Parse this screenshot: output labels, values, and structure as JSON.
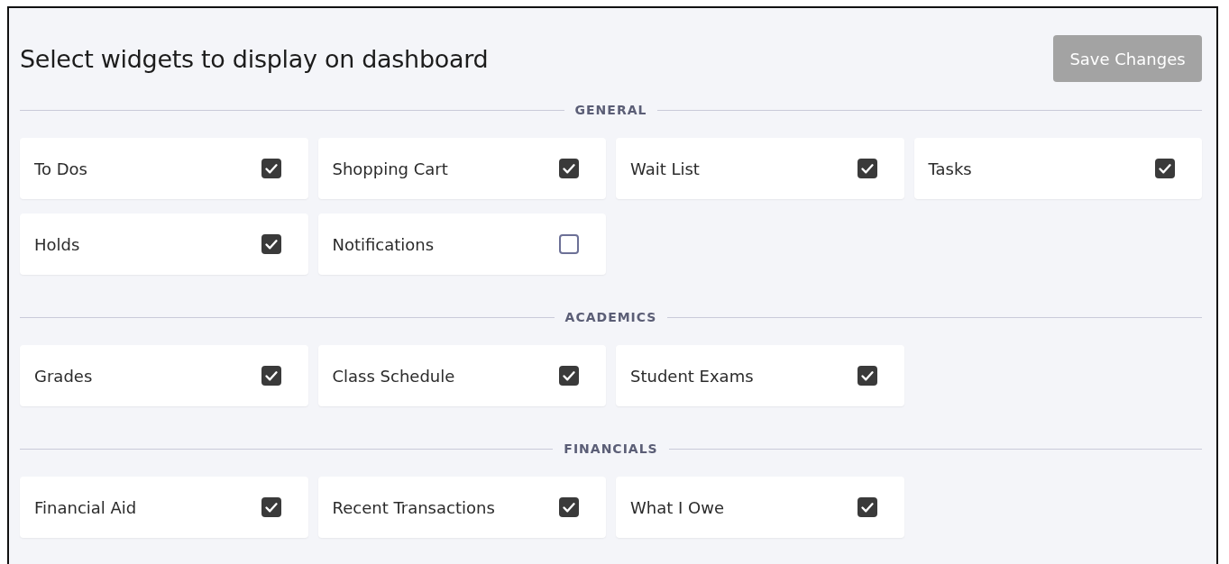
{
  "header": {
    "title": "Select widgets to display on dashboard",
    "save_button": {
      "label": "Save Changes",
      "disabled": true
    }
  },
  "sections": [
    {
      "title": "GENERAL",
      "widgets": [
        {
          "label": "To Dos",
          "checked": true
        },
        {
          "label": "Shopping Cart",
          "checked": true
        },
        {
          "label": "Wait List",
          "checked": true
        },
        {
          "label": "Tasks",
          "checked": true
        },
        {
          "label": "Holds",
          "checked": true
        },
        {
          "label": "Notifications",
          "checked": false
        }
      ]
    },
    {
      "title": "ACADEMICS",
      "widgets": [
        {
          "label": "Grades",
          "checked": true
        },
        {
          "label": "Class Schedule",
          "checked": true
        },
        {
          "label": "Student Exams",
          "checked": true
        }
      ]
    },
    {
      "title": "FINANCIALS",
      "widgets": [
        {
          "label": "Financial Aid",
          "checked": true
        },
        {
          "label": "Recent Transactions",
          "checked": true
        },
        {
          "label": "What I Owe",
          "checked": true
        }
      ]
    }
  ]
}
